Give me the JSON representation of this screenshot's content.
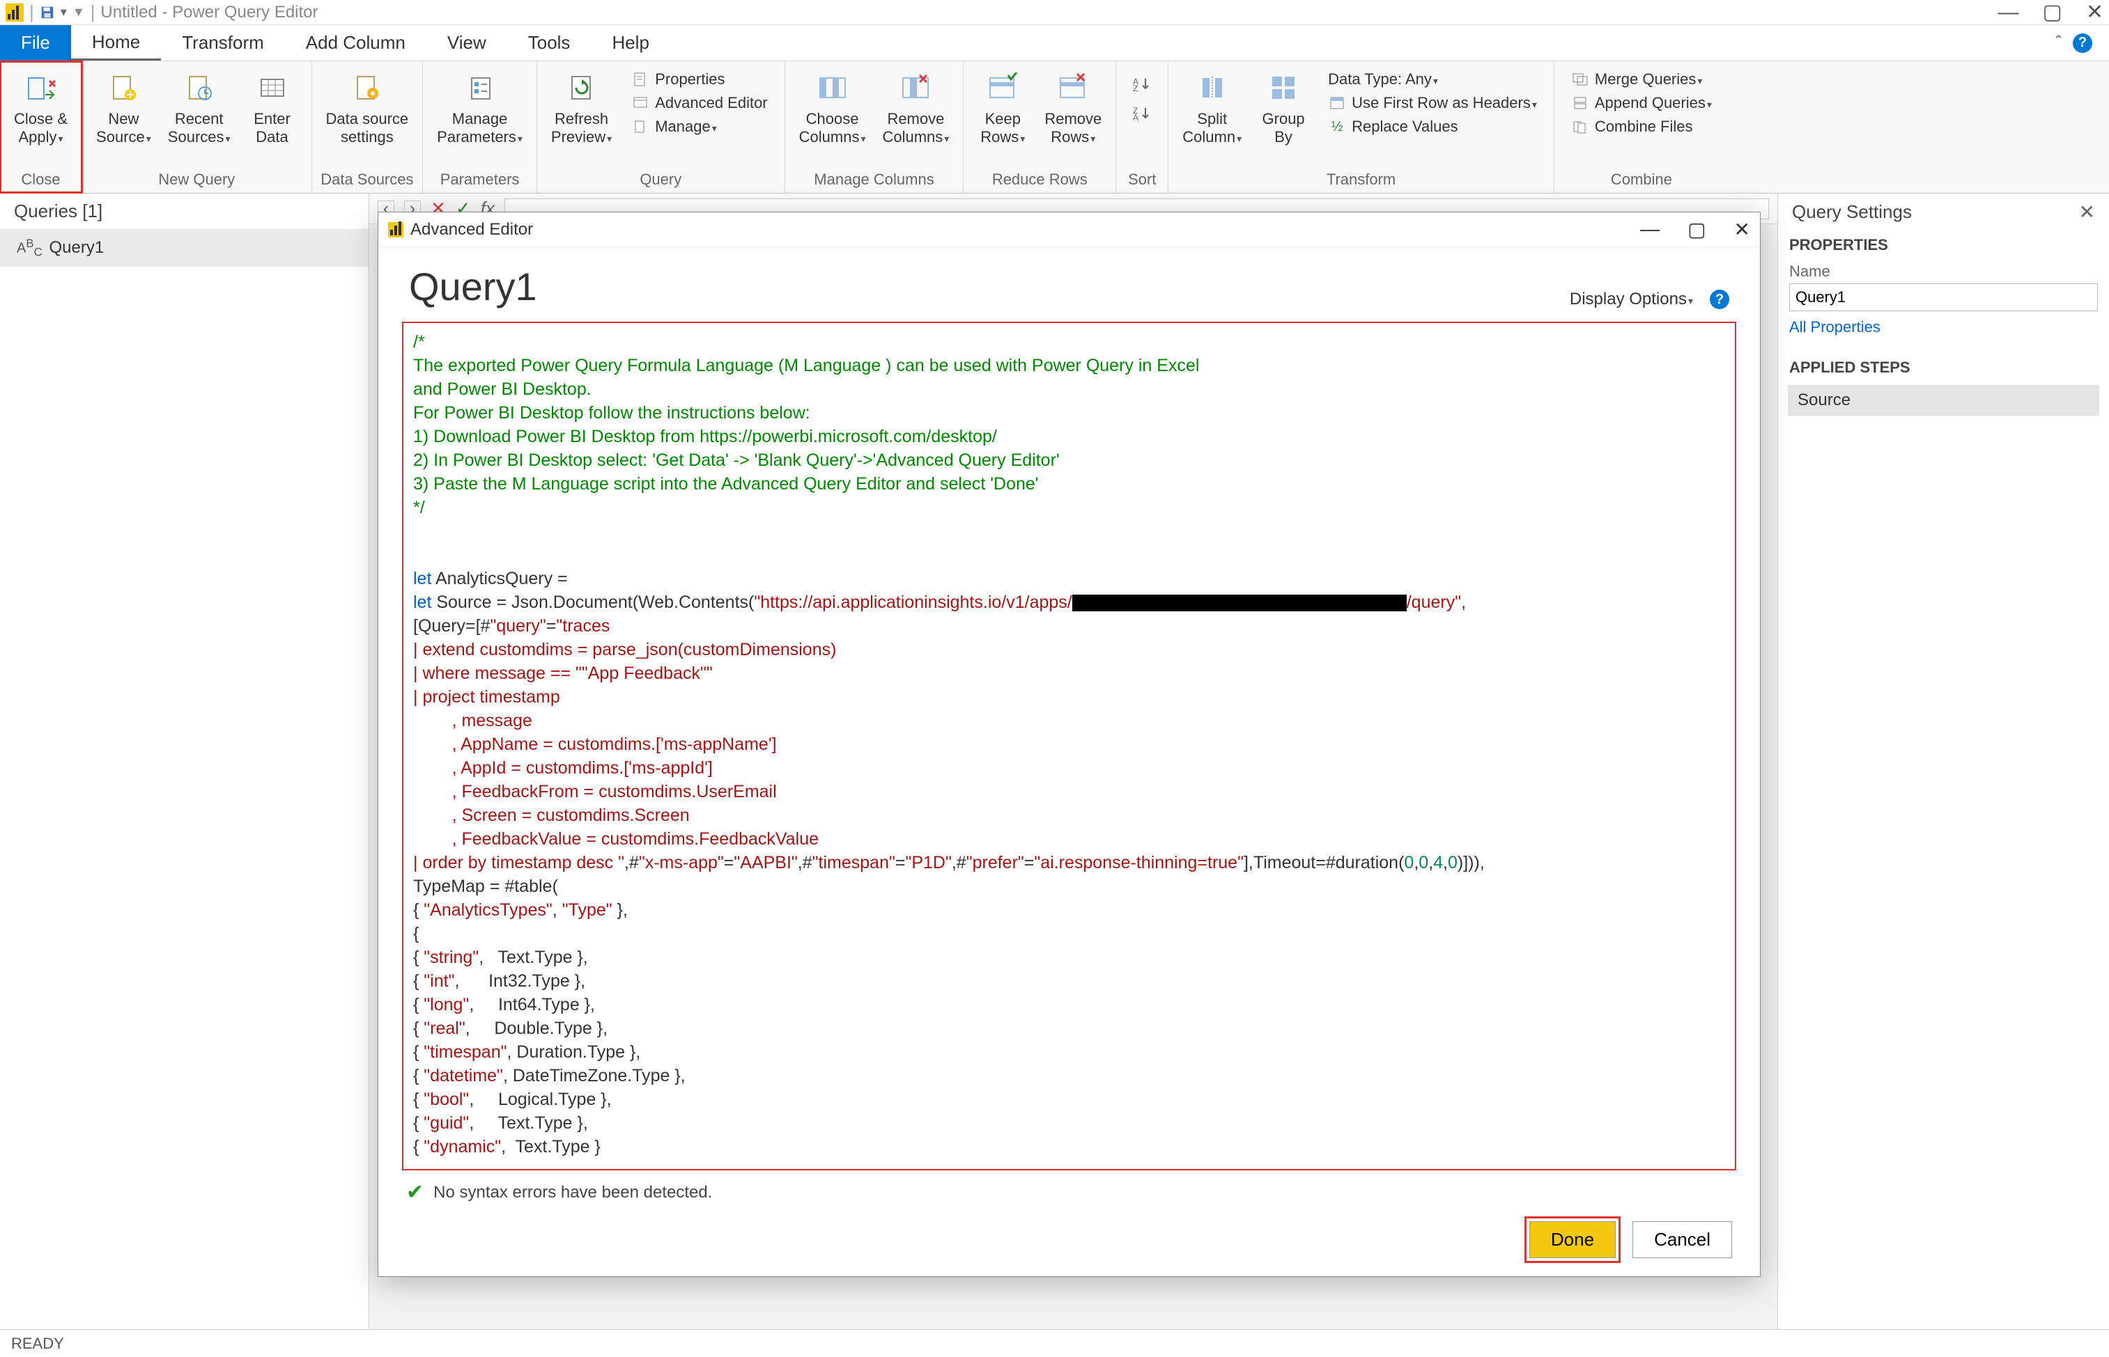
{
  "window": {
    "title": "Untitled - Power Query Editor"
  },
  "ribbonTabs": {
    "file": "File",
    "home": "Home",
    "transform": "Transform",
    "addColumn": "Add Column",
    "view": "View",
    "tools": "Tools",
    "help": "Help"
  },
  "ribbon": {
    "close": {
      "btn": "Close &\nApply",
      "group": "Close"
    },
    "newQuery": {
      "new": "New\nSource",
      "recent": "Recent\nSources",
      "enter": "Enter\nData",
      "group": "New Query"
    },
    "dataSources": {
      "settings": "Data source\nsettings",
      "group": "Data Sources"
    },
    "parameters": {
      "manage": "Manage\nParameters",
      "group": "Parameters"
    },
    "query": {
      "refresh": "Refresh\nPreview",
      "properties": "Properties",
      "advanced": "Advanced Editor",
      "manage": "Manage",
      "group": "Query"
    },
    "manageColumns": {
      "choose": "Choose\nColumns",
      "remove": "Remove\nColumns",
      "group": "Manage Columns"
    },
    "reduceRows": {
      "keep": "Keep\nRows",
      "remove": "Remove\nRows",
      "group": "Reduce Rows"
    },
    "sort": {
      "group": "Sort"
    },
    "transform": {
      "split": "Split\nColumn",
      "group": "Group\nBy",
      "datatype": "Data Type: Any",
      "firstrow": "Use First Row as Headers",
      "replace": "Replace Values",
      "groupLabel": "Transform"
    },
    "combine": {
      "merge": "Merge Queries",
      "append": "Append Queries",
      "combine": "Combine Files",
      "group": "Combine"
    }
  },
  "queries": {
    "header": "Queries [1]",
    "item": "Query1"
  },
  "settings": {
    "header": "Query Settings",
    "propSection": "PROPERTIES",
    "nameLabel": "Name",
    "nameValue": "Query1",
    "allProps": "All Properties",
    "stepsSection": "APPLIED STEPS",
    "step": "Source"
  },
  "fx": {
    "label": "fx"
  },
  "status": {
    "text": "READY"
  },
  "dialog": {
    "title": "Advanced Editor",
    "queryName": "Query1",
    "displayOptions": "Display Options",
    "syntaxMsg": "No syntax errors have been detected.",
    "done": "Done",
    "cancel": "Cancel",
    "code": {
      "c1": "/*",
      "c2": "The exported Power Query Formula Language (M Language ) can be used with Power Query in Excel",
      "c3": "and Power BI Desktop.",
      "c4": "For Power BI Desktop follow the instructions below:",
      "c5": "1) Download Power BI Desktop from https://powerbi.microsoft.com/desktop/",
      "c6": "2) In Power BI Desktop select: 'Get Data' -> 'Blank Query'->'Advanced Query Editor'",
      "c7": "3) Paste the M Language script into the Advanced Query Editor and select 'Done'",
      "c8": "*/",
      "l1a": "let",
      "l1b": " AnalyticsQuery =",
      "l2a": "let",
      "l2b": " Source = Json.Document(Web.Contents(",
      "l2c": "\"https://api.applicationinsights.io/v1/apps/",
      "l2d": "/query\"",
      "l2e": ",",
      "l3a": "[Query=[#",
      "l3b": "\"query\"",
      "l3c": "=",
      "l3d": "\"traces",
      "l4": "| extend customdims = parse_json(customDimensions)",
      "l5": "| where message == \"\"App Feedback\"\"",
      "l6": "| project timestamp",
      "l7": "        , message",
      "l8": "        , AppName = customdims.['ms-appName']",
      "l9": "        , AppId = customdims.['ms-appId']",
      "l10": "        , FeedbackFrom = customdims.UserEmail",
      "l11": "        , Screen = customdims.Screen",
      "l12": "        , FeedbackValue = customdims.FeedbackValue",
      "l13a": "| order by timestamp desc \"",
      "l13b": ",#",
      "l13c": "\"x-ms-app\"",
      "l13d": "=",
      "l13e": "\"AAPBI\"",
      "l13f": ",#",
      "l13g": "\"timespan\"",
      "l13h": "=",
      "l13i": "\"P1D\"",
      "l13j": ",#",
      "l13k": "\"prefer\"",
      "l13l": "=",
      "l13m": "\"ai.response-thinning=true\"",
      "l13n": "],Timeout=#duration(",
      "l13o": "0",
      "l13p": ",",
      "l13q": "0",
      "l13r": ",",
      "l13s": "4",
      "l13t": ",",
      "l13u": "0",
      "l13v": ")])),",
      "l14": "TypeMap = #table(",
      "l15a": "{ ",
      "l15b": "\"AnalyticsTypes\"",
      "l15c": ", ",
      "l15d": "\"Type\"",
      "l15e": " },",
      "l16": "{",
      "t1a": "{ ",
      "t1b": "\"string\"",
      "t1c": ",   Text.Type },",
      "t2a": "{ ",
      "t2b": "\"int\"",
      "t2c": ",      Int32.Type },",
      "t3a": "{ ",
      "t3b": "\"long\"",
      "t3c": ",     Int64.Type },",
      "t4a": "{ ",
      "t4b": "\"real\"",
      "t4c": ",     Double.Type },",
      "t5a": "{ ",
      "t5b": "\"timespan\"",
      "t5c": ", Duration.Type },",
      "t6a": "{ ",
      "t6b": "\"datetime\"",
      "t6c": ", DateTimeZone.Type },",
      "t7a": "{ ",
      "t7b": "\"bool\"",
      "t7c": ",     Logical.Type },",
      "t8a": "{ ",
      "t8b": "\"guid\"",
      "t8c": ",     Text.Type },",
      "t9a": "{ ",
      "t9b": "\"dynamic\"",
      "t9c": ",  Text.Type }"
    }
  }
}
